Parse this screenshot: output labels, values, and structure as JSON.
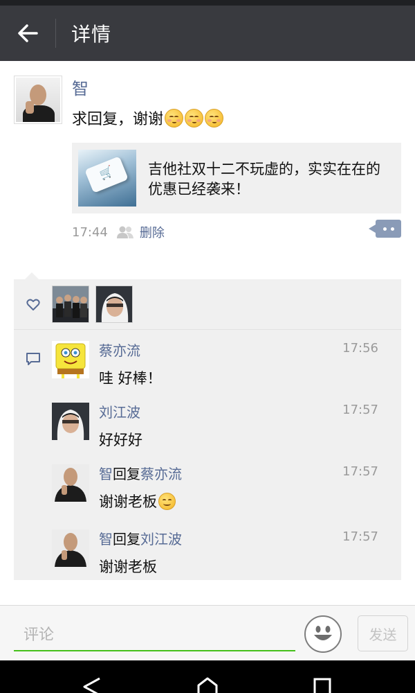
{
  "header": {
    "title": "详情"
  },
  "post": {
    "author": "智",
    "text": "求回复，谢谢",
    "emoji_count": 3,
    "emoji": "smiling-face-icon",
    "link_card": {
      "title": "吉他社双十二不玩虚的，实实在在的优惠已经袭来！"
    },
    "time": "17:44",
    "delete_label": "删除"
  },
  "likes": [
    {
      "avatar": "group-photo-avatar"
    },
    {
      "avatar": "hoodie-avatar"
    }
  ],
  "comments": [
    {
      "author": "蔡亦流",
      "reply_word": "",
      "reply_to": "",
      "time": "17:56",
      "text": "哇 好棒！",
      "avatar": "sponge-avatar"
    },
    {
      "author": "刘江波",
      "reply_word": "",
      "reply_to": "",
      "time": "17:57",
      "text": "好好好",
      "avatar": "hoodie-avatar"
    },
    {
      "author": "智",
      "reply_word": "回复",
      "reply_to": "蔡亦流",
      "time": "17:57",
      "text": "谢谢老板",
      "avatar": "man-avatar",
      "emoji": "smile-icon"
    },
    {
      "author": "智",
      "reply_word": "回复",
      "reply_to": "刘江波",
      "time": "17:57",
      "text": "谢谢老板",
      "avatar": "man-avatar"
    }
  ],
  "input": {
    "placeholder": "评论",
    "value": ""
  },
  "send_label": "发送",
  "colors": {
    "header_bg": "#393a3f",
    "link_blue": "#576b95",
    "input_underline": "#45c01a",
    "panel_bg": "#f0f0f0"
  }
}
